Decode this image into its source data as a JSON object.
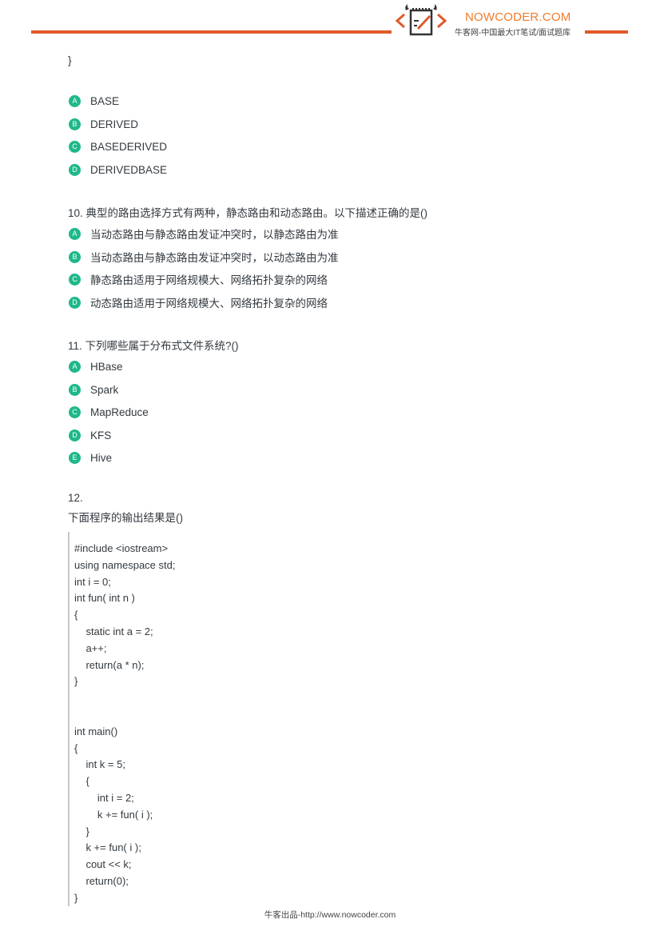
{
  "header": {
    "brand": "NOWCODER.COM",
    "tagline": "牛客网-中国最大IT笔试/面试题库",
    "logo_icon": "notepad-pencil-code-icon",
    "accent_color": "#e05a2a",
    "brand_color": "#f07c2a"
  },
  "prev_question": {
    "closing_brace": "}",
    "options": [
      {
        "letter": "A",
        "label": "BASE"
      },
      {
        "letter": "B",
        "label": "DERIVED"
      },
      {
        "letter": "C",
        "label": "BASEDERIVED"
      },
      {
        "letter": "D",
        "label": "DERIVEDBASE"
      }
    ]
  },
  "q10": {
    "title": "10. 典型的路由选择方式有两种，静态路由和动态路由。以下描述正确的是()",
    "options": [
      {
        "letter": "A",
        "label": "当动态路由与静态路由发证冲突时，以静态路由为准"
      },
      {
        "letter": "B",
        "label": "当动态路由与静态路由发证冲突时，以动态路由为准"
      },
      {
        "letter": "C",
        "label": "静态路由适用于网络规模大、网络拓扑复杂的网络"
      },
      {
        "letter": "D",
        "label": "动态路由适用于网络规模大、网络拓扑复杂的网络"
      }
    ]
  },
  "q11": {
    "title": "11. 下列哪些属于分布式文件系统?()",
    "options": [
      {
        "letter": "A",
        "label": "HBase"
      },
      {
        "letter": "B",
        "label": "Spark"
      },
      {
        "letter": "C",
        "label": "MapReduce"
      },
      {
        "letter": "D",
        "label": "KFS"
      },
      {
        "letter": "E",
        "label": "Hive"
      }
    ]
  },
  "q12": {
    "number": "12.",
    "title": "下面程序的输出结果是()",
    "code": [
      "#include <iostream>",
      "using namespace std;",
      "int i = 0;",
      "int fun( int n )",
      "{",
      "    static int a = 2;",
      "    a++;",
      "    return(a * n);",
      "}",
      "",
      "",
      "int main()",
      "{",
      "    int k = 5;",
      "    {",
      "        int i = 2;",
      "        k += fun( i );",
      "    }",
      "    k += fun( i );",
      "    cout << k;",
      "    return(0);",
      "}"
    ]
  },
  "footer": {
    "text": "牛客出品-http://www.nowcoder.com"
  },
  "colors": {
    "option_badge": "#1fb88a",
    "code_bar": "#c8c8c8"
  }
}
